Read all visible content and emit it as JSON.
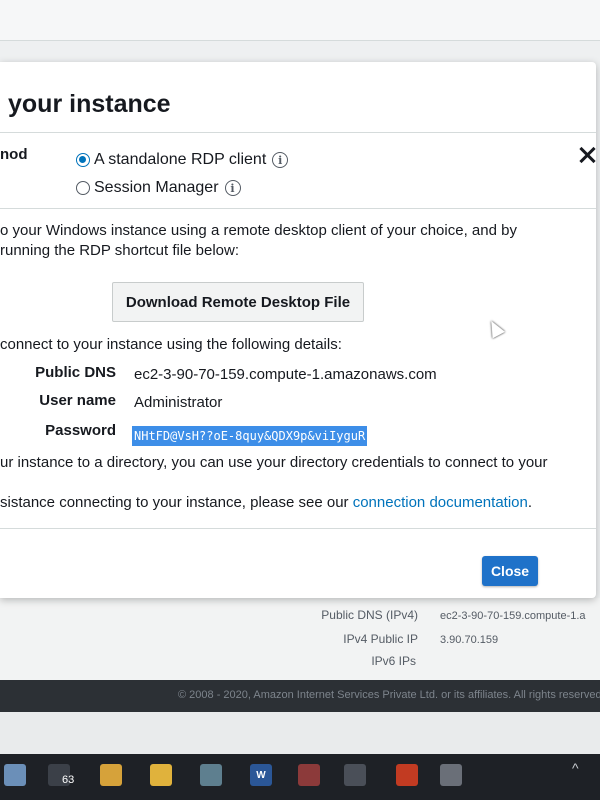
{
  "modal": {
    "title": "your instance",
    "method_label": "nod",
    "options": [
      {
        "label": "A standalone RDP client",
        "selected": true
      },
      {
        "label": "Session Manager",
        "selected": false
      }
    ],
    "intro_line1": "o your Windows instance using a remote desktop client of your choice, and by",
    "intro_line2": "running the RDP shortcut file below:",
    "download_label": "Download Remote Desktop File",
    "details_intro": "connect to your instance using the following details:",
    "details": {
      "public_dns_label": "Public DNS",
      "public_dns_value": "ec2-3-90-70-159.compute-1.amazonaws.com",
      "username_label": "User name",
      "username_value": "Administrator",
      "password_label": "Password",
      "password_value": "NHtFD@VsH??oE-8quy&QDX9p&viIyguR"
    },
    "directory_note": "ur instance to a directory, you can use your directory credentials to connect to your",
    "assist_prefix": "sistance connecting to your instance, please see our ",
    "assist_link": "connection documentation",
    "assist_suffix": ".",
    "close_label": "Close"
  },
  "background": {
    "public_dns_ipv4_label": "Public DNS (IPv4)",
    "public_dns_ipv4_value": "ec2-3-90-70-159.compute-1.a",
    "ipv4_public_ip_label": "IPv4 Public IP",
    "ipv4_public_ip_value": "3.90.70.159",
    "ipv6_ips_label": "IPv6 IPs",
    "footer": "© 2008 - 2020, Amazon Internet Services Private Ltd. or its affiliates. All rights reserved."
  },
  "taskbar": {
    "badge": "63",
    "chevron": "^"
  },
  "colors": {
    "primary_button": "#1f72c9",
    "link": "#0073bb",
    "selection": "#3d8ee8"
  }
}
